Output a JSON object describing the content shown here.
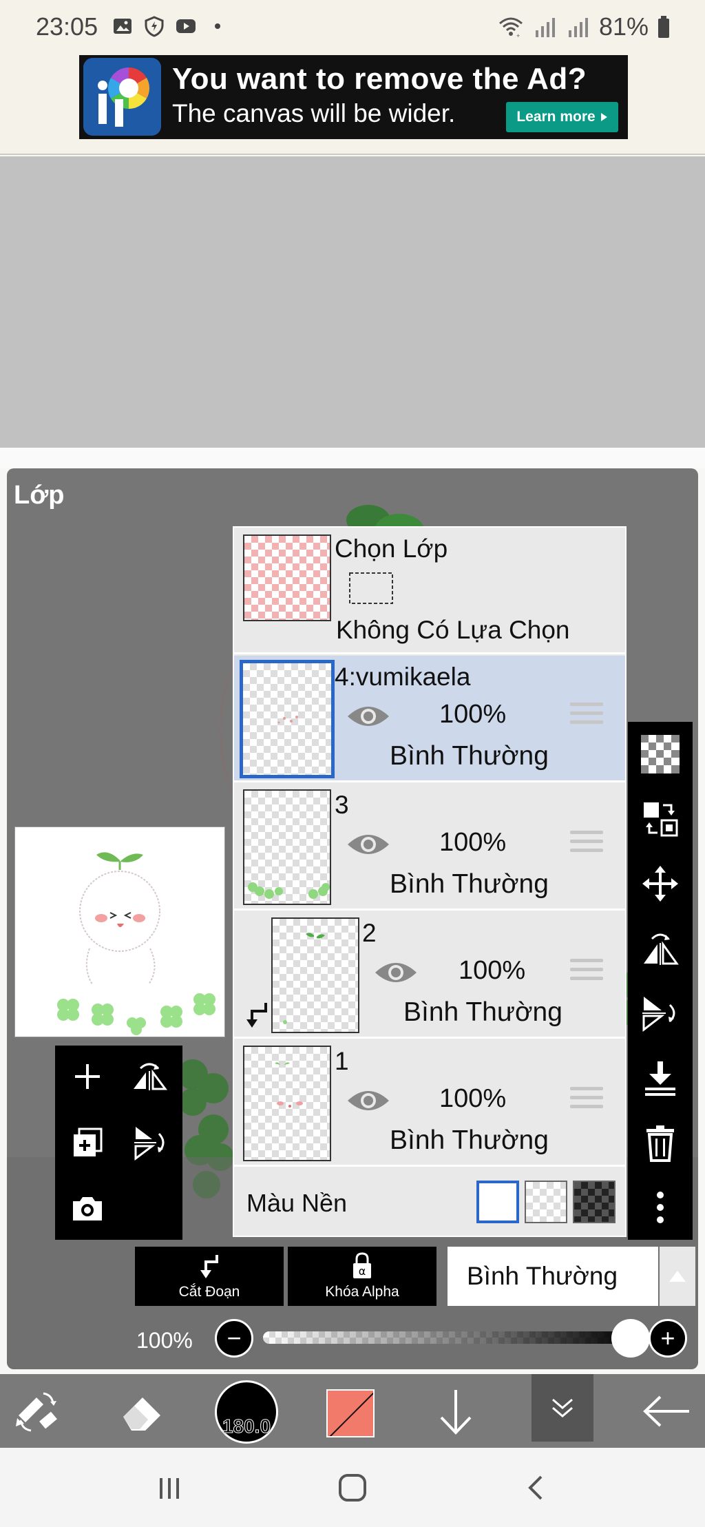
{
  "status_bar": {
    "time": "23:05",
    "battery": "81%",
    "icons": [
      "gallery-icon",
      "shield-icon",
      "youtube-icon",
      "dot-icon",
      "wifi-icon",
      "signal-icon",
      "signal-icon",
      "battery-icon"
    ]
  },
  "ad": {
    "title": "You want to remove the Ad?",
    "subtitle": "The canvas will be wider.",
    "button": "Learn more"
  },
  "panel": {
    "title": "Lớp"
  },
  "selection_layer": {
    "title": "Chọn Lớp",
    "status": "Không Có Lựa Chọn"
  },
  "layers": [
    {
      "name": "4:vumikaela",
      "opacity": "100%",
      "blend": "Bình Thường",
      "selected": true,
      "clipped": false
    },
    {
      "name": "3",
      "opacity": "100%",
      "blend": "Bình Thường",
      "selected": false,
      "clipped": false
    },
    {
      "name": "2",
      "opacity": "100%",
      "blend": "Bình Thường",
      "selected": false,
      "clipped": true
    },
    {
      "name": "1",
      "opacity": "100%",
      "blend": "Bình Thường",
      "selected": false,
      "clipped": false
    }
  ],
  "background": {
    "label": "Màu Nền",
    "options": [
      "white",
      "transparent",
      "dark"
    ],
    "selected": "white"
  },
  "controls": {
    "clip_label": "Cắt Đoạn",
    "alpha_lock_label": "Khóa Alpha",
    "blend_mode": "Bình Thường",
    "opacity_label": "100%",
    "opacity_value": 1.0
  },
  "toolbar": {
    "brush_size": "180.0",
    "primary_color": "#f27a6b"
  },
  "colors": {
    "selected_layer_bg": "#cdd8ea",
    "selection_border": "#2a67c9",
    "ad_button": "#0a9a86"
  }
}
